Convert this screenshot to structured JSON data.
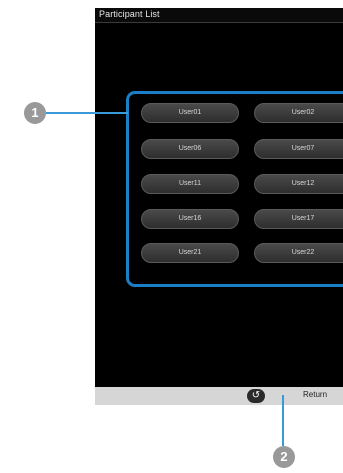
{
  "screen": {
    "title": "Participant List"
  },
  "users": [
    {
      "label": "User01"
    },
    {
      "label": "User02"
    },
    {
      "label": "User06"
    },
    {
      "label": "User07"
    },
    {
      "label": "User11"
    },
    {
      "label": "User12"
    },
    {
      "label": "User16"
    },
    {
      "label": "User17"
    },
    {
      "label": "User21"
    },
    {
      "label": "User22"
    }
  ],
  "bottom_bar": {
    "return_label": "Return",
    "return_icon": "return-arrow-icon"
  },
  "callouts": {
    "one": "1",
    "two": "2"
  },
  "colors": {
    "panel_border": "#1a7fc6",
    "screen_bg": "#000000",
    "bottom_bar_bg": "#d6d6d6",
    "callout": "#999999"
  }
}
